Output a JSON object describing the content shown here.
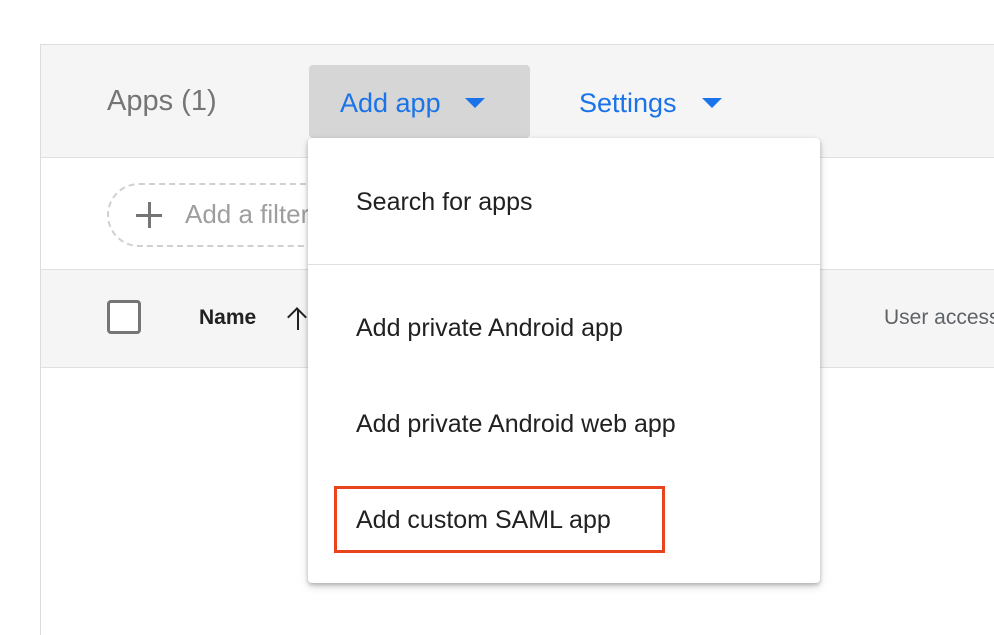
{
  "header": {
    "title": "Apps (1)",
    "add_app_label": "Add app",
    "settings_label": "Settings"
  },
  "filter": {
    "placeholder": "Add a filter"
  },
  "table": {
    "columns": [
      "Name",
      "User access"
    ]
  },
  "menu": {
    "items": [
      {
        "label": "Search for apps"
      },
      {
        "label": "Add private Android app"
      },
      {
        "label": "Add private Android web app"
      },
      {
        "label": "Add custom SAML app"
      }
    ],
    "highlighted_item": "Add custom SAML app"
  },
  "colors": {
    "accent": "#1a73e8",
    "highlight_border": "#e8441d",
    "header_bg": "#f5f5f5",
    "button_active_bg": "#d6d6d6"
  },
  "icons": {
    "caret": "caret-down-icon",
    "plus": "plus-icon",
    "sort": "arrow-up-icon",
    "checkbox": "checkbox-icon"
  }
}
